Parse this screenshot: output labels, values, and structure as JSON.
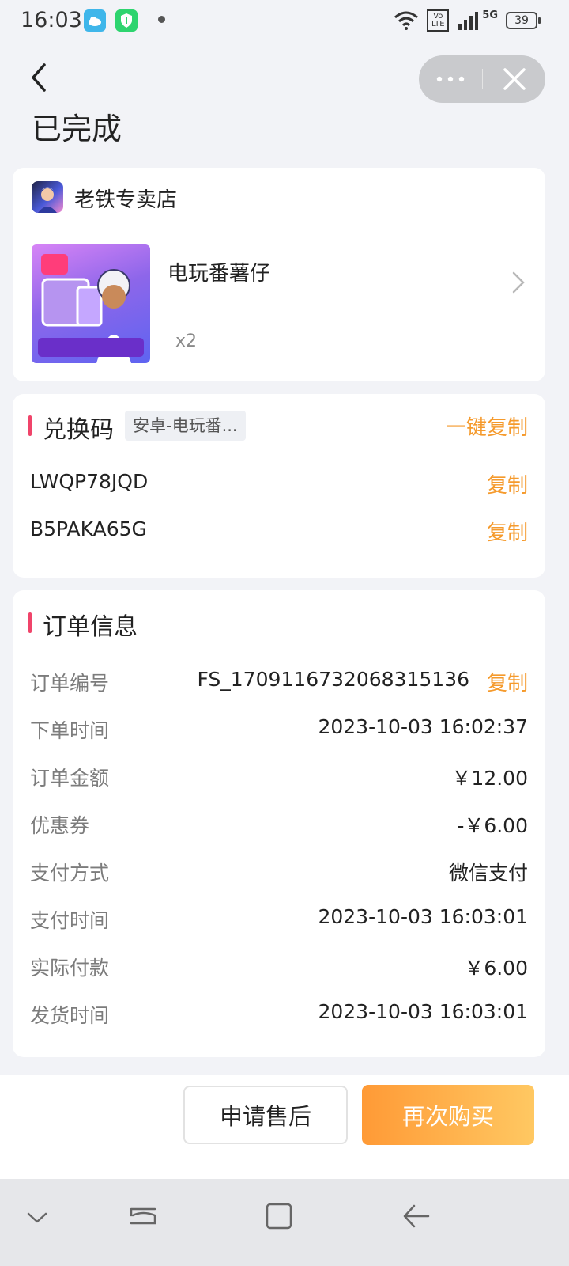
{
  "status_bar": {
    "time": "16:03",
    "icons": [
      "weather-cloud-icon",
      "shield-app-icon",
      "notification-dot",
      "wifi-icon",
      "volte-icon",
      "signal-icon",
      "5g-icon"
    ],
    "network": "5G",
    "volte": "Vo LTE",
    "battery": "39"
  },
  "header": {
    "title": "已完成",
    "more_icon": "more-dots-icon",
    "close_icon": "close-icon"
  },
  "order_item": {
    "shop_name": "老铁专卖店",
    "product_name": "电玩番薯仔",
    "quantity": "x2"
  },
  "redeem": {
    "title": "兑换码",
    "tag": "安卓-电玩番...",
    "copy_all": "一键复制",
    "codes": [
      {
        "code": "LWQP78JQD",
        "copy": "复制"
      },
      {
        "code": "B5PAKA65G",
        "copy": "复制"
      }
    ]
  },
  "order_info": {
    "title": "订单信息",
    "copy": "复制",
    "rows": [
      {
        "label": "订单编号",
        "value": "FS_1709116732068315136"
      },
      {
        "label": "下单时间",
        "value": "2023-10-03 16:02:37"
      },
      {
        "label": "订单金额",
        "value": "￥12.00"
      },
      {
        "label": "优惠券",
        "value": "-￥6.00"
      },
      {
        "label": "支付方式",
        "value": "微信支付"
      },
      {
        "label": "支付时间",
        "value": "2023-10-03 16:03:01"
      },
      {
        "label": "实际付款",
        "value": "￥6.00"
      },
      {
        "label": "发货时间",
        "value": "2023-10-03 16:03:01"
      }
    ]
  },
  "actions": {
    "after_sale": "申请售后",
    "buy_again": "再次购买"
  },
  "colors": {
    "accent_orange": "#f59a2c",
    "section_bar": "#f0446a",
    "background": "#f2f3f7"
  }
}
